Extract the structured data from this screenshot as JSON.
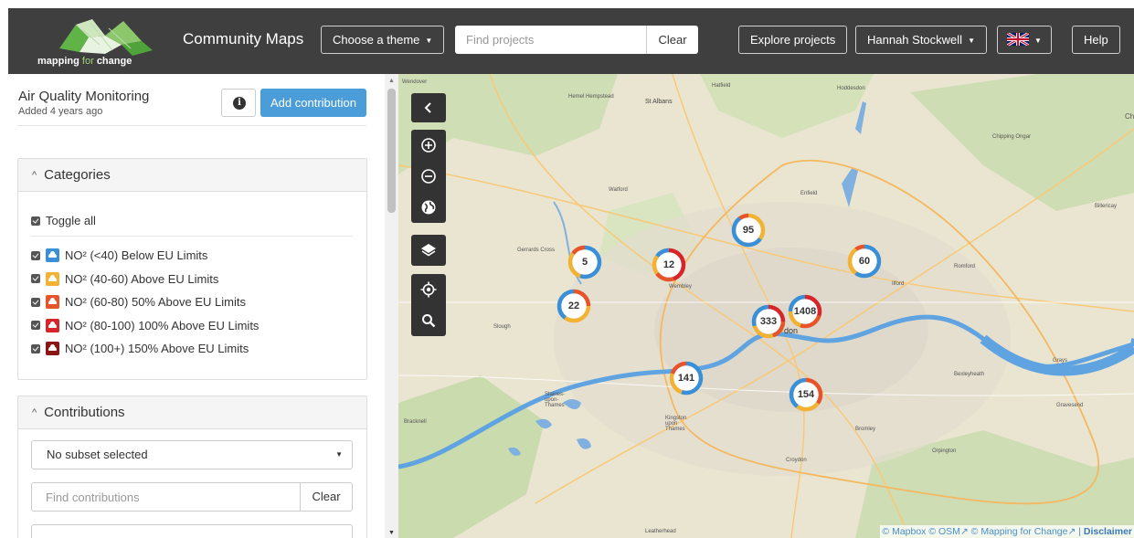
{
  "navbar": {
    "logo_text_bold": "mapping",
    "logo_text_thin": "for",
    "logo_text_tail": "change",
    "brand": "Community Maps",
    "theme_button": "Choose a theme",
    "search_placeholder": "Find projects",
    "search_clear": "Clear",
    "explore_button": "Explore projects",
    "user_button": "Hannah Stockwell",
    "language_icon": "uk-flag-icon",
    "help_button": "Help"
  },
  "project": {
    "title": "Air Quality Monitoring",
    "added": "Added 4 years ago",
    "add_contribution": "Add contribution"
  },
  "categories": {
    "heading": "Categories",
    "toggle_all": "Toggle all",
    "items": [
      {
        "label": "NO² (<40) Below EU Limits",
        "color": "#3a8fd6"
      },
      {
        "label": "NO² (40-60) Above EU Limits",
        "color": "#f2b233"
      },
      {
        "label": "NO² (60-80) 50% Above EU Limits",
        "color": "#e8542a"
      },
      {
        "label": "NO² (80-100) 100% Above EU Limits",
        "color": "#d7262b"
      },
      {
        "label": "NO² (100+) 150% Above EU Limits",
        "color": "#8b1414"
      }
    ]
  },
  "contributions": {
    "heading": "Contributions",
    "subset_select": "No subset selected",
    "search_placeholder": "Find contributions",
    "search_clear": "Clear"
  },
  "map": {
    "controls": [
      "collapse-panel-icon",
      "zoom-in-icon",
      "zoom-out-icon",
      "globe-icon",
      "layers-icon",
      "locate-icon",
      "search-icon"
    ],
    "clusters": [
      {
        "count": "5"
      },
      {
        "count": "12"
      },
      {
        "count": "95"
      },
      {
        "count": "60"
      },
      {
        "count": "22"
      },
      {
        "count": "333"
      },
      {
        "count": "1408"
      },
      {
        "count": "141"
      },
      {
        "count": "154"
      }
    ],
    "place_labels": {
      "wendover": "Wendover",
      "hemel": "Hemel Hempstead",
      "stalbans": "St Albans",
      "hatfield": "Hatfield",
      "hoddesdon": "Hoddesdon",
      "chipping": "Chipping Ongar",
      "watford": "Watford",
      "enfield": "Enfield",
      "billericay": "Billericay",
      "gerrards": "Gerrards Cross",
      "wembley": "Wembley",
      "romford": "Romford",
      "ilford": "Ilford",
      "slough": "Slough",
      "don": "don",
      "bexleyheath": "Bexleyheath",
      "grays": "Grays",
      "gravesend": "Gravesend",
      "staines": "Staines-upon-Thames",
      "bracknell": "Bracknell",
      "kingston": "Kingston upon Thames",
      "bromley": "Bromley",
      "orpington": "Orpington",
      "croydon": "Croydon",
      "leatherhead": "Leatherhead",
      "che": "Che"
    },
    "attribution": {
      "mapbox": "© Mapbox",
      "osm": "© OSM",
      "mfc": "© Mapping for Change",
      "sep": "|",
      "disclaimer": "Disclaimer"
    }
  }
}
